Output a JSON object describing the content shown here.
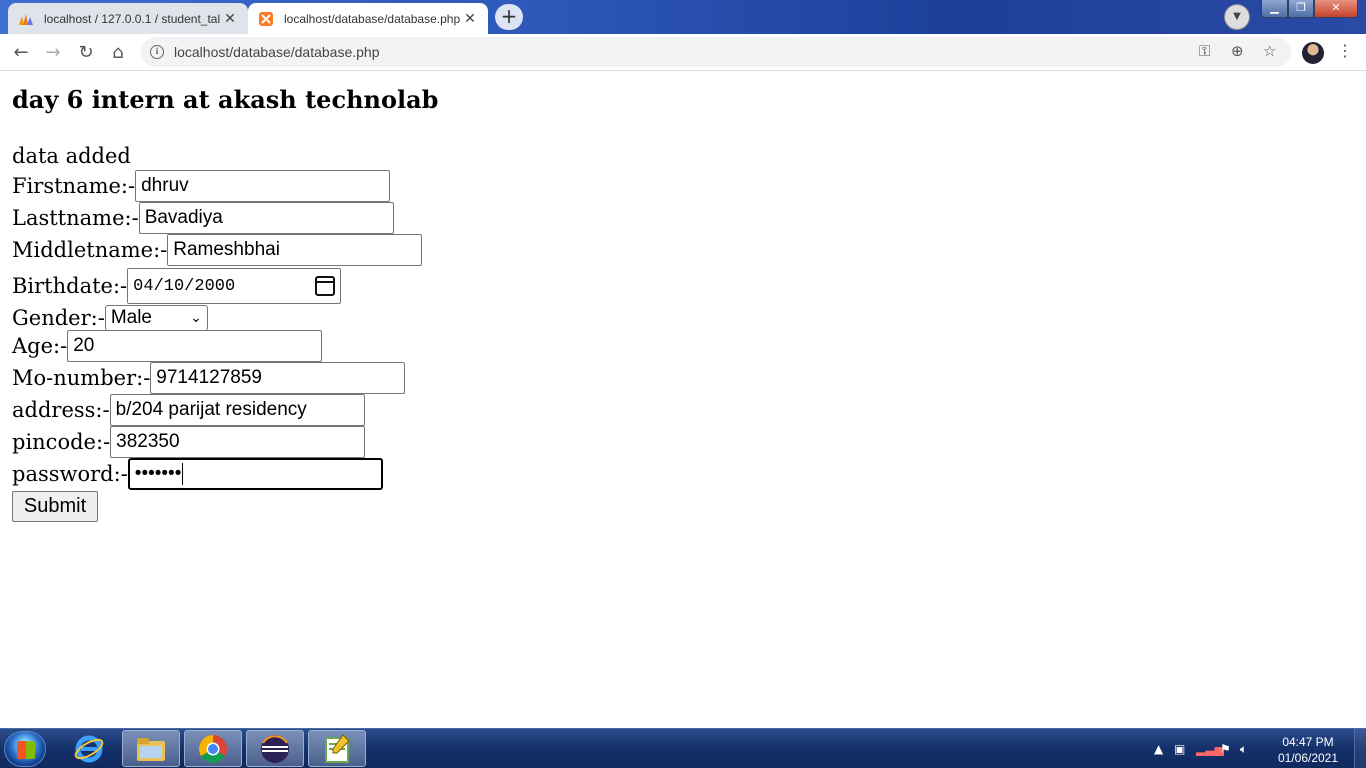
{
  "browser": {
    "tabs": [
      {
        "title": "localhost / 127.0.0.1 / student_tal",
        "icon": "phpmyadmin-icon",
        "active": false
      },
      {
        "title": "localhost/database/database.php",
        "icon": "xampp-icon",
        "active": true
      }
    ],
    "new_tab_label": "+",
    "address_url": "localhost/database/database.php"
  },
  "page": {
    "heading": "day 6 intern at akash technolab",
    "status_message": "data added",
    "fields": {
      "firstname": {
        "label": "Firstname:-",
        "value": "dhruv"
      },
      "lastname": {
        "label": "Lasttname:-",
        "value": "Bavadiya"
      },
      "middlename": {
        "label": "Middletname:-",
        "value": "Rameshbhai"
      },
      "birthdate": {
        "label": "Birthdate:-",
        "value": "04/10/2000"
      },
      "gender": {
        "label": "Gender:-",
        "value": "Male"
      },
      "age": {
        "label": "Age:-",
        "value": "20"
      },
      "mobile": {
        "label": "Mo-number:-",
        "value": "9714127859"
      },
      "address": {
        "label": "address:-",
        "value": "b/204 parijat residency"
      },
      "pincode": {
        "label": "pincode:-",
        "value": "382350"
      },
      "password": {
        "label": "password:-",
        "value": "•••••••"
      }
    },
    "submit_label": "Submit"
  },
  "taskbar": {
    "time": "04:47 PM",
    "date": "01/06/2021",
    "pinned": [
      "internet-explorer-icon",
      "file-explorer-icon",
      "chrome-icon",
      "eclipse-icon",
      "notepad-plus-plus-icon"
    ]
  },
  "colors": {
    "taskbar": "#14306a",
    "tabstrip": "#2d57b8",
    "omnibox": "#f1f3f4"
  }
}
